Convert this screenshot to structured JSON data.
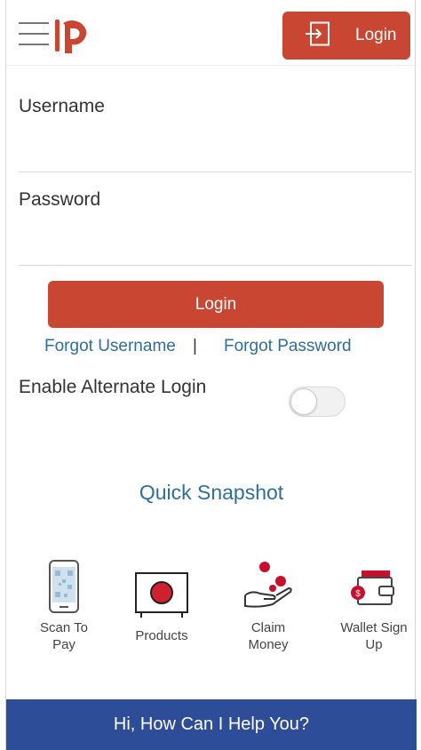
{
  "header": {
    "login_label": "Login",
    "brand_color": "#c84632"
  },
  "form": {
    "username_label": "Username",
    "username_value": "",
    "password_label": "Password",
    "password_value": "",
    "login_button": "Login",
    "forgot_username": "Forgot Username",
    "separator": "|",
    "forgot_password": "Forgot Password",
    "alternate_login_label": "Enable Alternate Login",
    "alternate_login_enabled": false
  },
  "quick_snapshot": {
    "title": "Quick Snapshot",
    "items": [
      {
        "label_line1": "Scan To",
        "label_line2": "Pay",
        "icon": "phone-qr-icon"
      },
      {
        "label_line1": "Products",
        "label_line2": "",
        "icon": "products-icon"
      },
      {
        "label_line1": "Claim",
        "label_line2": "Money",
        "icon": "hand-coins-icon"
      },
      {
        "label_line1": "Wallet Sign",
        "label_line2": "Up",
        "icon": "wallet-icon"
      }
    ]
  },
  "help_bar": {
    "label": "Hi, How Can I Help You?",
    "color": "#2e4d98"
  },
  "colors": {
    "accent_red": "#c84632",
    "link_blue": "#2d6f9c"
  }
}
